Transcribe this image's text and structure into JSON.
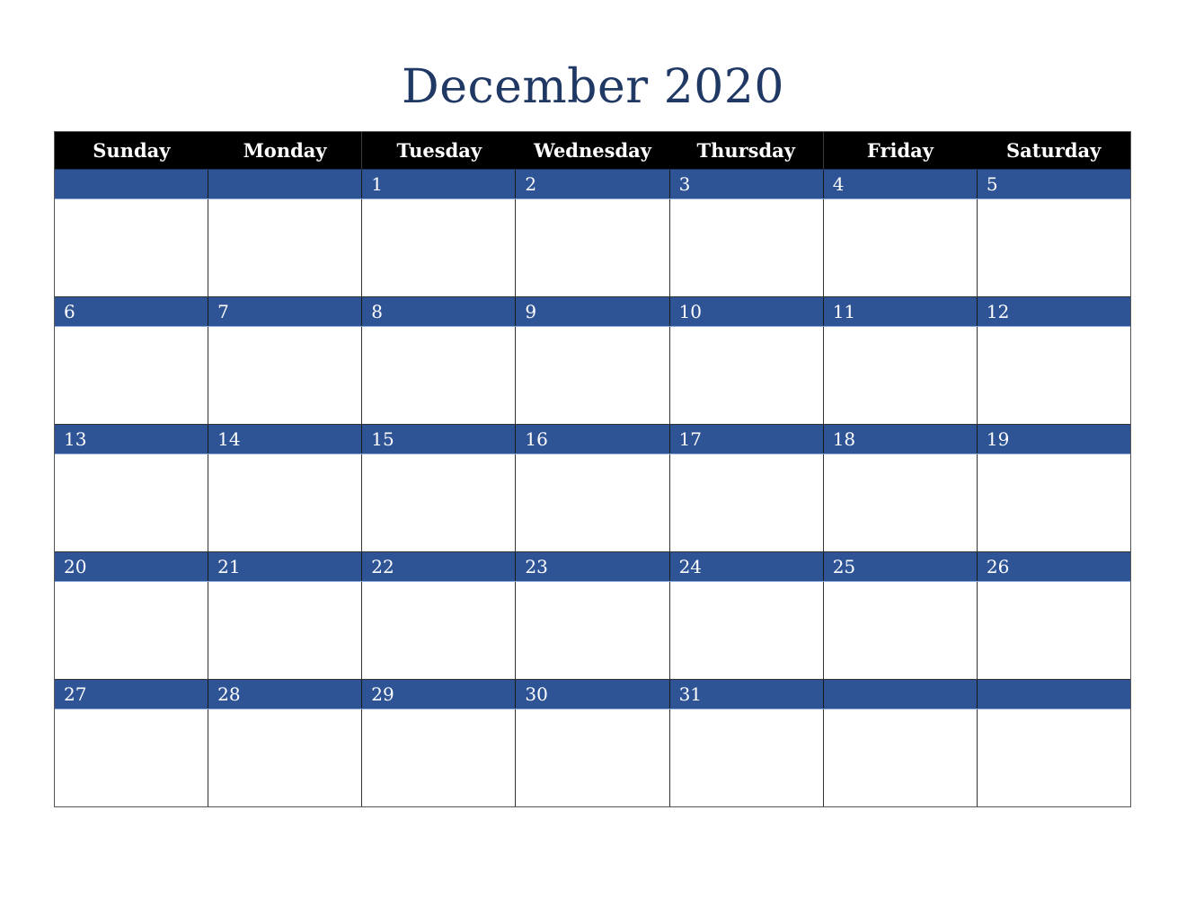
{
  "title": "December 2020",
  "colors": {
    "title": "#1F3864",
    "header_bg": "#000000",
    "header_text": "#FFFFFF",
    "date_band": "#2F5496",
    "date_text": "#FFFFFF"
  },
  "weekdays": [
    "Sunday",
    "Monday",
    "Tuesday",
    "Wednesday",
    "Thursday",
    "Friday",
    "Saturday"
  ],
  "weeks": [
    [
      "",
      "",
      "1",
      "2",
      "3",
      "4",
      "5"
    ],
    [
      "6",
      "7",
      "8",
      "9",
      "10",
      "11",
      "12"
    ],
    [
      "13",
      "14",
      "15",
      "16",
      "17",
      "18",
      "19"
    ],
    [
      "20",
      "21",
      "22",
      "23",
      "24",
      "25",
      "26"
    ],
    [
      "27",
      "28",
      "29",
      "30",
      "31",
      "",
      ""
    ]
  ]
}
